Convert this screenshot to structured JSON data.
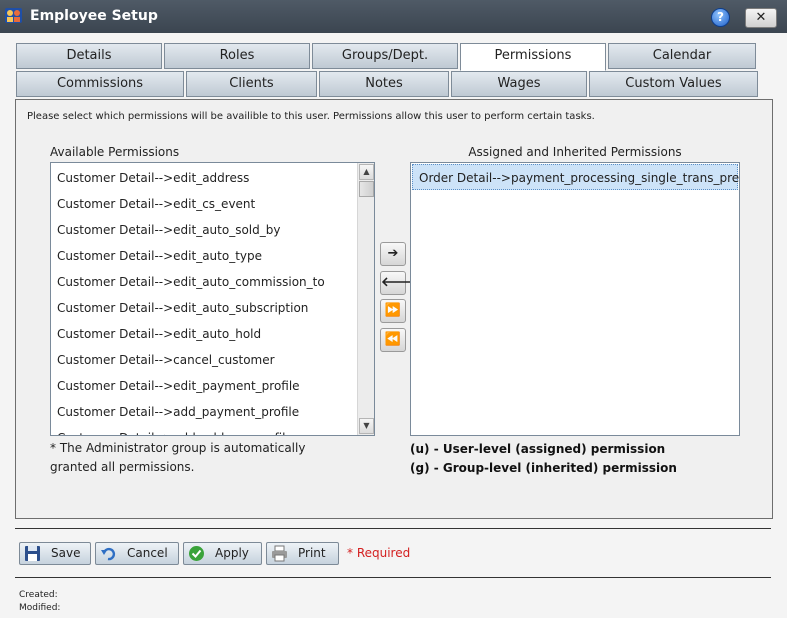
{
  "window": {
    "title": "Employee Setup",
    "help_label": "?",
    "close_label": "✕"
  },
  "tabs_row1": [
    "Details",
    "Roles",
    "Groups/Dept.",
    "Permissions",
    "Calendar"
  ],
  "tabs_row2": [
    "Commissions",
    "Clients",
    "Notes",
    "Wages",
    "Custom Values"
  ],
  "active_tab": "Permissions",
  "permissions": {
    "instructions": "Please select which permissions will be availible to this user. Permissions allow this user to perform certain tasks.",
    "available_label": "Available Permissions",
    "assigned_label": "Assigned and Inherited Permissions",
    "available_items": [
      "Customer Detail-->edit_address",
      "Customer Detail-->edit_cs_event",
      "Customer Detail-->edit_auto_sold_by",
      "Customer Detail-->edit_auto_type",
      "Customer Detail-->edit_auto_commission_to",
      "Customer Detail-->edit_auto_subscription",
      "Customer Detail-->edit_auto_hold",
      "Customer Detail-->cancel_customer",
      "Customer Detail-->edit_payment_profile",
      "Customer Detail-->add_payment_profile",
      "Customer Detail-->add_address_profile"
    ],
    "assigned_items": [
      "Order Detail-->payment_processing_single_trans_pref"
    ],
    "move_buttons": {
      "add": "➔",
      "remove": "🡐",
      "add_all": "⏩",
      "remove_all": "⏪"
    },
    "admin_note": "* The Administrator group is automatically granted all permissions.",
    "legend_user": "(u) - User-level (assigned) permission",
    "legend_group": "(g) - Group-level (inherited) permission"
  },
  "footer": {
    "save_label": "Save",
    "cancel_label": "Cancel",
    "apply_label": "Apply",
    "print_label": "Print",
    "required_label": "* Required",
    "created_label": "Created:",
    "modified_label": "Modified:"
  }
}
